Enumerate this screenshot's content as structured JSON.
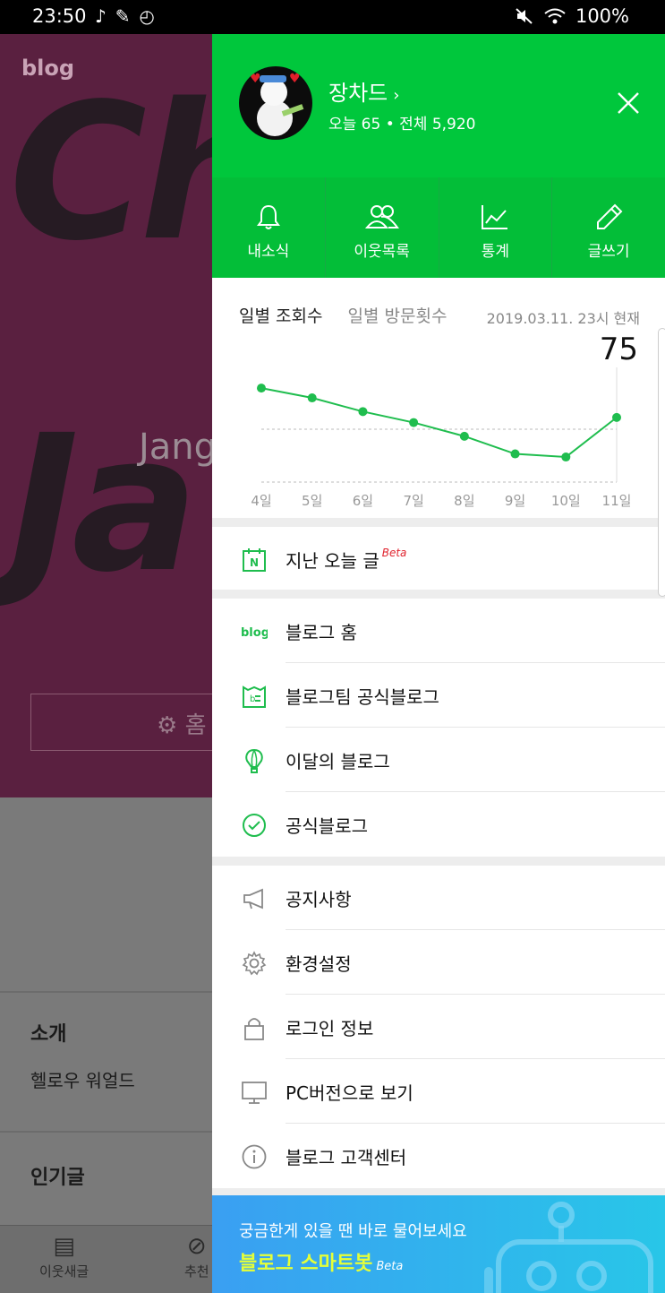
{
  "status_bar": {
    "time": "23:50",
    "battery": "100%",
    "left_icons": [
      "music-note-icon",
      "feather-icon",
      "timer-icon"
    ],
    "right_icons": [
      "mute-icon",
      "wifi-icon"
    ]
  },
  "background_page": {
    "logo": "blog",
    "cover_text_1": "Ch",
    "cover_text_2": "Ja",
    "cover_name": "Jang",
    "home_button": "홈",
    "intro_title": "소개",
    "intro_text": "헬로우 워얼드",
    "popular_title": "인기글",
    "tabs": [
      {
        "label": "이웃새글",
        "icon": "news-icon"
      },
      {
        "label": "추천",
        "icon": "compass-icon"
      }
    ]
  },
  "drawer": {
    "profile": {
      "name": "장차드",
      "stats": "오늘 65 • 전체 5,920"
    },
    "quick_actions": [
      {
        "label": "내소식",
        "icon": "bell-icon"
      },
      {
        "label": "이웃목록",
        "icon": "neighbors-icon"
      },
      {
        "label": "통계",
        "icon": "chart-icon"
      },
      {
        "label": "글쓰기",
        "icon": "pencil-icon"
      }
    ],
    "stats": {
      "tab_active": "일별 조회수",
      "tab_inactive": "일별 방문횟수",
      "date": "2019.03.11. 23시 현재",
      "count": "75"
    },
    "past_today": {
      "label": "지난 오늘 글",
      "badge": "Beta"
    },
    "menu_group_1": [
      {
        "label": "블로그 홈",
        "icon": "blog-logo-icon"
      },
      {
        "label": "블로그팀 공식블로그",
        "icon": "blogteam-icon"
      },
      {
        "label": "이달의 블로그",
        "icon": "balloon-icon"
      },
      {
        "label": "공식블로그",
        "icon": "check-circle-icon"
      }
    ],
    "menu_group_2": [
      {
        "label": "공지사항",
        "icon": "megaphone-icon"
      },
      {
        "label": "환경설정",
        "icon": "gear-icon"
      },
      {
        "label": "로그인 정보",
        "icon": "lock-icon"
      },
      {
        "label": "PC버전으로 보기",
        "icon": "monitor-icon"
      },
      {
        "label": "블로그 고객센터",
        "icon": "info-icon"
      }
    ],
    "banner": {
      "question": "궁금한게 있을 땐 바로 물어보세요",
      "name": "블로그 스마트봇",
      "badge": "Beta"
    }
  },
  "colors": {
    "brand_green": "#00c73c",
    "icon_green": "#1fbd4e",
    "beta_red": "#e0232e",
    "bot_name": "#e5ff38"
  },
  "chart_data": {
    "type": "line",
    "categories": [
      "4일",
      "5일",
      "6일",
      "7일",
      "8일",
      "9일",
      "10일",
      "11일"
    ],
    "values": [
      240,
      215,
      180,
      152,
      117,
      72,
      64,
      165
    ],
    "grid": "dashed horizontal",
    "legend": "none",
    "ylim": [
      0,
      270
    ]
  }
}
